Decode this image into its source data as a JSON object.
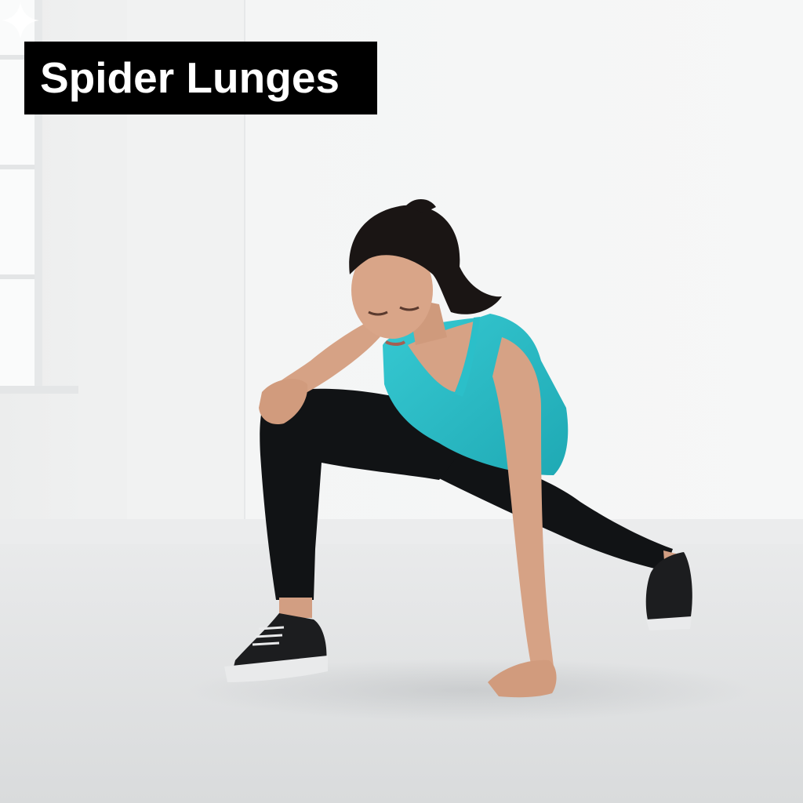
{
  "title": "Spider Lunges",
  "icons": {
    "watermark": "sparkle-icon"
  },
  "colors": {
    "title_background": "#000000",
    "title_text": "#ffffff",
    "wall": "#f4f5f5",
    "floor": "#dfe1e2",
    "tank_top": "#2bbfc9",
    "leggings": "#111315",
    "hair": "#1a1514",
    "skin": "#d6a285",
    "shoes": "#1c1d1f",
    "soles": "#e9eaeb"
  }
}
